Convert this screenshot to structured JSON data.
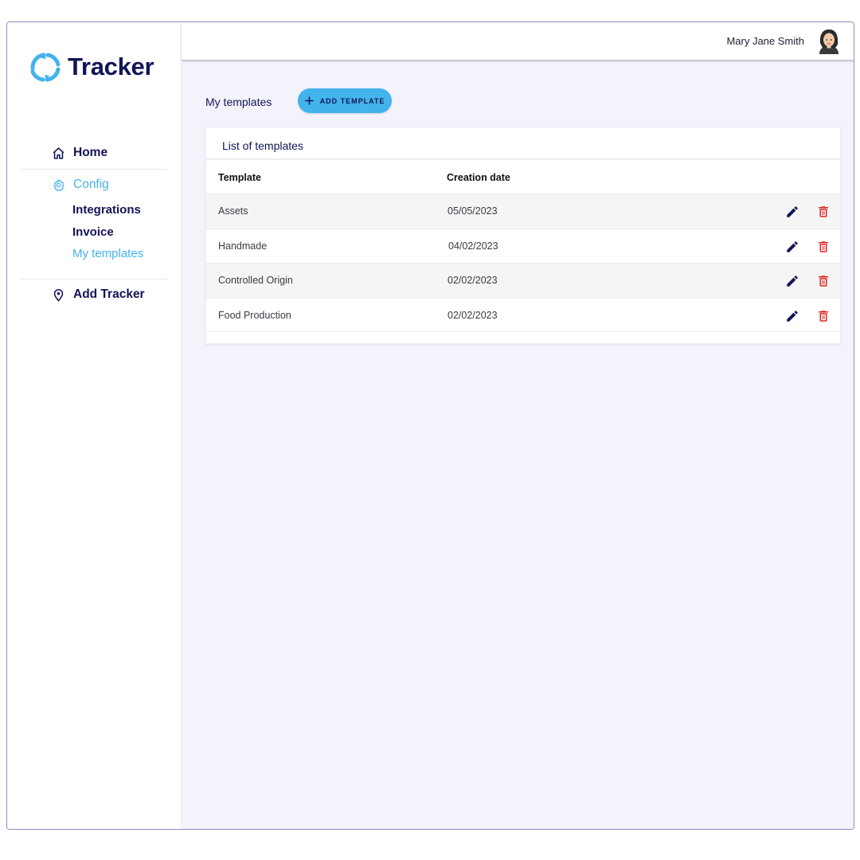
{
  "brand": {
    "name": "Tracker",
    "color": "#111456",
    "accent": "#43b3ec"
  },
  "sidebar": {
    "items": [
      {
        "label": "Home",
        "icon": "home-icon"
      },
      {
        "label": "Config",
        "icon": "gear-icon",
        "active": true,
        "children": [
          {
            "label": "Integrations"
          },
          {
            "label": "Invoice"
          },
          {
            "label": "My templates",
            "active": true
          }
        ]
      },
      {
        "label": "Add Tracker",
        "icon": "location-pin-icon"
      }
    ]
  },
  "header": {
    "user_name": "Mary Jane Smith",
    "avatar": "user-avatar"
  },
  "main": {
    "title": "My templates",
    "add_button_label": "ADD TEMPLATE",
    "card_title": "List of templates",
    "table": {
      "columns": [
        "Template",
        "Creation date"
      ],
      "rows": [
        {
          "template": "Assets",
          "date": "05/05/2023"
        },
        {
          "template": "Handmade",
          "date": "04/02/2023"
        },
        {
          "template": "Controlled Origin",
          "date": "02/02/2023"
        },
        {
          "template": "Food Production",
          "date": "02/02/2023"
        }
      ],
      "actions": [
        "edit-icon",
        "delete-icon"
      ],
      "colors": {
        "edit": "#111456",
        "delete": "#e02424"
      }
    }
  }
}
